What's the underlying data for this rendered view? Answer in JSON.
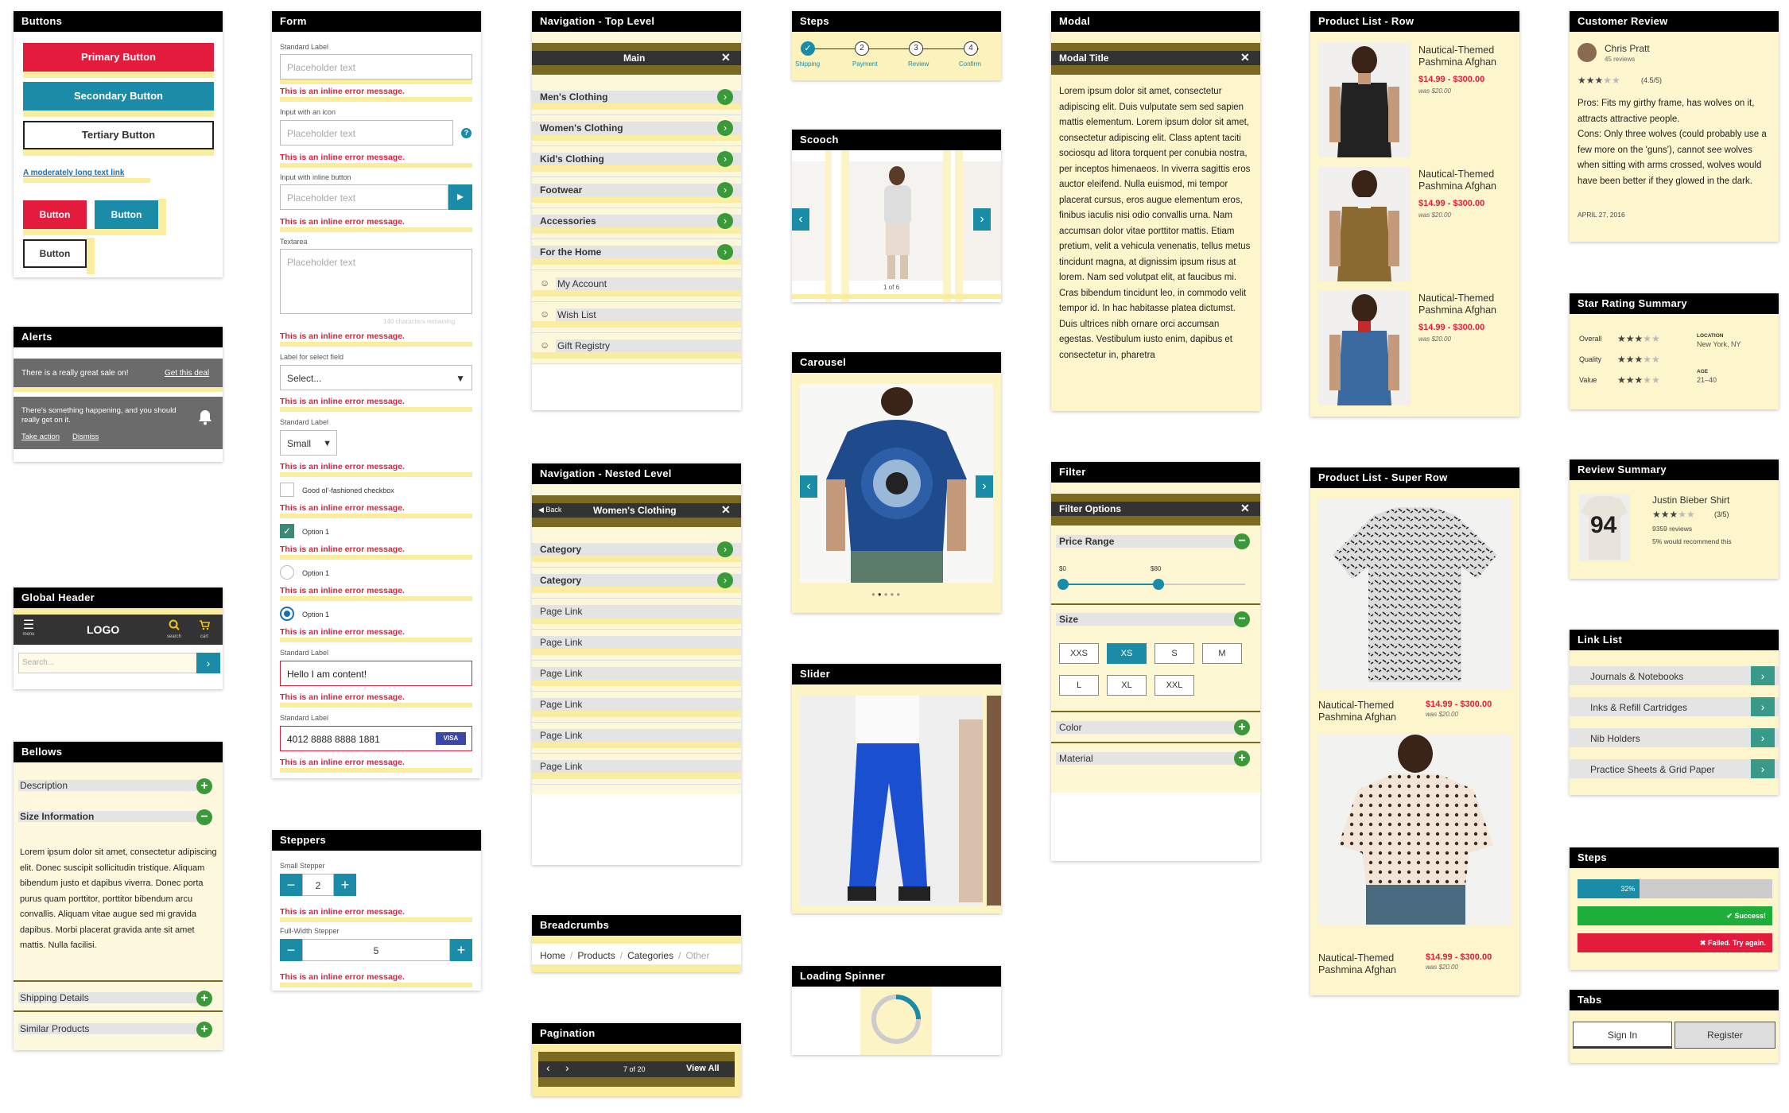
{
  "buttons": {
    "title": "Buttons",
    "primary": "Primary Button",
    "secondary": "Secondary Button",
    "tertiary": "Tertiary Button",
    "link": "A moderately long text link",
    "small1": "Button",
    "small2": "Button",
    "small3": "Button"
  },
  "alerts": {
    "title": "Alerts",
    "a1": "There is a really great sale on!",
    "a1_link": "Get this deal",
    "a2": "There's something happening, and you should really get on it.",
    "a2_action": "Take action",
    "a2_dismiss": "Dismiss"
  },
  "global_header": {
    "title": "Global Header",
    "menu": "menu",
    "logo": "LOGO",
    "search": "search",
    "cart": "cart",
    "search_placeholder": "Search..."
  },
  "bellows": {
    "title": "Bellows",
    "description": "Description",
    "size_info": "Size Information",
    "body": "Lorem ipsum dolor sit amet, consectetur adipiscing elit. Donec suscipit sollicitudin tristique. Aliquam bibendum justo et dapibus viverra. Donec porta purus quam porttitor, porttitor bibendum arcu convallis. Aliquam vitae augue sed mi gravida dapibus. Morbi placerat gravida ante sit amet mattis. Nulla facilisi.",
    "shipping": "Shipping Details",
    "similar": "Similar Products"
  },
  "form": {
    "title": "Form",
    "std_label": "Standard Label",
    "placeholder": "Placeholder text",
    "error": "This is an inline error message.",
    "input_icon": "Input with an icon",
    "input_btn": "Input with inline button",
    "textarea": "Textarea",
    "chars": "140 characters remaining",
    "select_label": "Label for select field",
    "select": "Select...",
    "std_label2": "Standard Label",
    "small": "Small",
    "checkbox": "Good ol'-fashioned checkbox",
    "option1": "Option 1",
    "content": "Hello I am content!",
    "card": "4012 8888 8888 1881",
    "visa": "VISA"
  },
  "steppers": {
    "title": "Steppers",
    "small": "Small Stepper",
    "small_val": "2",
    "full": "Full-Width Stepper",
    "full_val": "5",
    "error": "This is an inline error message."
  },
  "nav_top": {
    "title": "Navigation - Top Level",
    "main": "Main",
    "items": [
      "Men's Clothing",
      "Women's Clothing",
      "Kid's Clothing",
      "Footwear",
      "Accessories",
      "For the Home"
    ],
    "account": [
      "My Account",
      "Wish List",
      "Gift Registry"
    ]
  },
  "nav_nested": {
    "title": "Navigation - Nested Level",
    "back": "Back",
    "header": "Women's Clothing",
    "cats": [
      "Category",
      "Category"
    ],
    "links": [
      "Page Link",
      "Page Link",
      "Page Link",
      "Page Link",
      "Page Link",
      "Page Link"
    ]
  },
  "breadcrumbs": {
    "title": "Breadcrumbs",
    "items": [
      "Home",
      "Products",
      "Categories",
      "Other"
    ]
  },
  "pagination": {
    "title": "Pagination",
    "page": "7 of 20",
    "view_all": "View All"
  },
  "steps_top": {
    "title": "Steps",
    "steps": [
      "Shipping",
      "Payment",
      "Review",
      "Confirm"
    ],
    "nums": [
      "2",
      "3",
      "4"
    ]
  },
  "scooch": {
    "title": "Scooch",
    "count": "1 of 6"
  },
  "carousel": {
    "title": "Carousel"
  },
  "slider": {
    "title": "Slider"
  },
  "spinner": {
    "title": "Loading Spinner"
  },
  "modal": {
    "title": "Modal",
    "modal_title": "Modal Title",
    "body": "Lorem ipsum dolor sit amet, consectetur adipiscing elit. Duis vulputate sem sed sapien mattis elementum. Lorem ipsum dolor sit amet, consectetur adipiscing elit. Class aptent taciti sociosqu ad litora torquent per conubia nostra, per inceptos himenaeos. In viverra sagittis eros auctor eleifend. Nulla euismod, mi tempor placerat cursus, eros augue elementum eros, finibus iaculis nisi odio convallis urna. Nam accumsan dolor vitae porttitor mattis. Etiam pretium, velit a vehicula venenatis, tellus metus tincidunt magna, at dignissim ipsum risus at lorem. Nam sed volutpat elit, at faucibus mi. Cras bibendum tincidunt leo, in commodo velit tempor id. In hac habitasse platea dictumst. Duis ultrices nibh ornare orci accumsan egestas. Vestibulum iusto enim, dapibus et consectetur in, pharetra"
  },
  "filter": {
    "title": "Filter",
    "options": "Filter Options",
    "price": "Price Range",
    "min": "$0",
    "max": "$80",
    "size": "Size",
    "sizes": [
      "XXS",
      "XS",
      "S",
      "M",
      "L",
      "XL",
      "XXL"
    ],
    "color": "Color",
    "material": "Material"
  },
  "product_row": {
    "title": "Product List - Row",
    "items": [
      {
        "name": "Nautical-Themed Pashmina Afghan",
        "price": "$14.99 - $300.00",
        "was": "was $20.00"
      },
      {
        "name": "Nautical-Themed Pashmina Afghan",
        "price": "$14.99 - $300.00",
        "was": "was $20.00"
      },
      {
        "name": "Nautical-Themed Pashmina Afghan",
        "price": "$14.99 - $300.00",
        "was": "was $20.00"
      }
    ]
  },
  "product_super": {
    "title": "Product List - Super Row",
    "items": [
      {
        "name": "Nautical-Themed Pashmina Afghan",
        "price": "$14.99 - $300.00",
        "was": "was $20.00"
      },
      {
        "name": "Nautical-Themed Pashmina Afghan",
        "price": "$14.99 - $300.00",
        "was": "was $20.00"
      }
    ]
  },
  "review": {
    "title": "Customer Review",
    "name": "Chris Pratt",
    "count": "45 reviews",
    "score": "(4.5/5)",
    "body": "Pros: Fits my girthy frame, has wolves on it, attracts attractive people.\nCons: Only three wolves (could probably use a few more on the 'guns'), cannot see wolves when sitting with arms crossed, wolves would have been better if they glowed in the dark.",
    "date": "APRIL 27, 2016"
  },
  "star_summary": {
    "title": "Star Rating Summary",
    "rows": [
      "Overall",
      "Quality",
      "Value"
    ],
    "location_label": "LOCATION",
    "location": "New York, NY",
    "age_label": "AGE",
    "age": "21–40"
  },
  "review_summary": {
    "title": "Review Summary",
    "name": "Justin Bieber Shirt",
    "score": "(3/5)",
    "reviews": "9359 reviews",
    "recommend": "5% would recommend this",
    "jersey": "94"
  },
  "link_list": {
    "title": "Link List",
    "items": [
      "Journals & Notebooks",
      "Inks & Refill Cartridges",
      "Nib Holders",
      "Practice Sheets & Grid Paper"
    ]
  },
  "steps_bottom": {
    "title": "Steps",
    "progress": 32,
    "progress_label": "32%",
    "success": "Success!",
    "failed": "Failed. Try again."
  },
  "tabs": {
    "title": "Tabs",
    "signin": "Sign In",
    "register": "Register"
  }
}
